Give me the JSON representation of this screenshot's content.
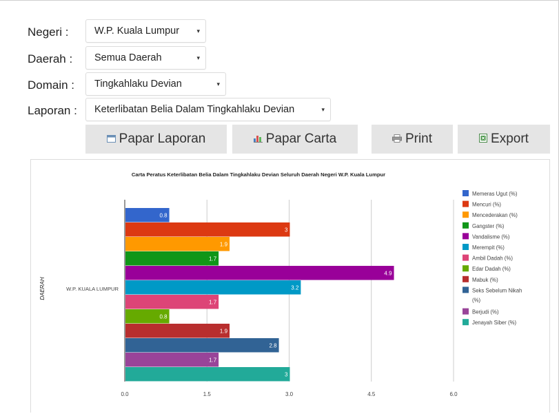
{
  "form": {
    "negeri": {
      "label": "Negeri :",
      "value": "W.P. Kuala Lumpur"
    },
    "daerah": {
      "label": "Daerah :",
      "value": "Semua Daerah"
    },
    "domain": {
      "label": "Domain :",
      "value": "Tingkahlaku Devian"
    },
    "laporan": {
      "label": "Laporan :",
      "value": "Keterlibatan Belia Dalam Tingkahlaku Devian"
    }
  },
  "buttons": {
    "papar_laporan": "Papar Laporan",
    "papar_carta": "Papar Carta",
    "print": "Print",
    "export": "Export"
  },
  "colors": {
    "button_bg": "#e5e5e5"
  },
  "chart_data": {
    "type": "bar",
    "orientation": "horizontal",
    "title": "Carta Peratus Keterlibatan Belia Dalam Tingkahlaku Devian Seluruh Daerah Negeri W.P. Kuala Lumpur",
    "ylabel": "DAERAH",
    "xlabel": "",
    "categories": [
      "W.P. KUALA LUMPUR"
    ],
    "xlim": [
      0,
      6
    ],
    "xticks": [
      "0.0",
      "1.5",
      "3.0",
      "4.5",
      "6.0"
    ],
    "grid": true,
    "legend_position": "right",
    "series": [
      {
        "name": "Memeras Ugut (%)",
        "values": [
          0.8
        ],
        "label": "0.8",
        "color": "#3366cc"
      },
      {
        "name": "Mencuri (%)",
        "values": [
          3
        ],
        "label": "3",
        "color": "#dc3912"
      },
      {
        "name": "Mencederakan (%)",
        "values": [
          1.9
        ],
        "label": "1.9",
        "color": "#ff9900"
      },
      {
        "name": "Gangster (%)",
        "values": [
          1.7
        ],
        "label": "1.7",
        "color": "#109618"
      },
      {
        "name": "Vandalisme (%)",
        "values": [
          4.9
        ],
        "label": "4.9",
        "color": "#990099"
      },
      {
        "name": "Merempit (%)",
        "values": [
          3.2
        ],
        "label": "3.2",
        "color": "#0099c6"
      },
      {
        "name": "Ambil Dadah (%)",
        "values": [
          1.7
        ],
        "label": "1.7",
        "color": "#dd4477"
      },
      {
        "name": "Edar Dadah (%)",
        "values": [
          0.8
        ],
        "label": "0.8",
        "color": "#66aa00"
      },
      {
        "name": "Mabuk (%)",
        "values": [
          1.9
        ],
        "label": "1.9",
        "color": "#b82e2e"
      },
      {
        "name": "Seks Sebelum Nikah (%)",
        "name_lines": [
          "Seks Sebelum Nikah",
          "(%)"
        ],
        "values": [
          2.8
        ],
        "label": "2.8",
        "color": "#316395"
      },
      {
        "name": "Berjudi (%)",
        "values": [
          1.7
        ],
        "label": "1.7",
        "color": "#994499"
      },
      {
        "name": "Jenayah Siber (%)",
        "values": [
          3
        ],
        "label": "3",
        "color": "#22aa99"
      }
    ]
  }
}
